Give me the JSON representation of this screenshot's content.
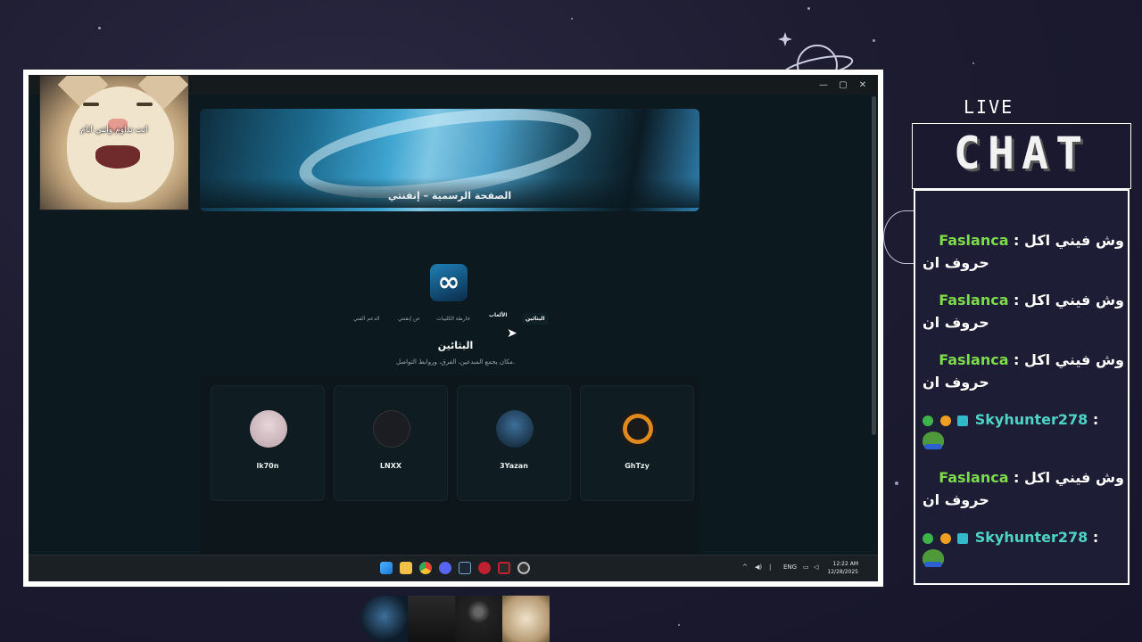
{
  "window": {
    "title": "",
    "controls": [
      "—",
      "▢",
      "✕"
    ]
  },
  "banner": {
    "caption": "الصفحة الرسمية – إنفنتي",
    "logo_text": "انفنتي"
  },
  "site": {
    "logo_glyph": "∞"
  },
  "nav": [
    {
      "label": "البثائين",
      "state": "active"
    },
    {
      "label": "الألعاب",
      "state": "hover"
    },
    {
      "label": "خارطة الكليبات",
      "state": "normal"
    },
    {
      "label": "عن إنفنتي",
      "state": "normal"
    },
    {
      "label": "الدعم الفني",
      "state": "normal"
    }
  ],
  "section": {
    "title": "البثائين",
    "subtitle": "مكان يجمع المبدعين، الفرق، وروابط التواصل."
  },
  "cards": [
    {
      "name": "lk70n",
      "avatar_color": "#cfc0c6"
    },
    {
      "name": "LNXX",
      "avatar_color": "#1b1d22"
    },
    {
      "name": "3Yazan",
      "avatar_color": "#1e3f5a"
    },
    {
      "name": "GhTzy",
      "avatar_color": "#1a1a1a"
    }
  ],
  "taskbar": {
    "icons": [
      "windows-icon",
      "file-explorer-icon",
      "chrome-icon",
      "discord-icon",
      "steam-icon",
      "app-red-icon",
      "app-redsq-icon",
      "obs-icon"
    ],
    "tray": {
      "language": "ENG",
      "time": "12:22 AM",
      "date": "12/28/2025"
    }
  },
  "webcam": {
    "caption": "انت تداوم وانتي انام"
  },
  "chat": {
    "live_label": "LIVE",
    "title": "CHAT",
    "messages": [
      {
        "user": "Faslanca",
        "text": "وش فيني اكل",
        "line2": "حروف ان",
        "type": "text"
      },
      {
        "user": "Faslanca",
        "text": "وش فيني اكل",
        "line2": "حروف ان",
        "type": "text"
      },
      {
        "user": "Faslanca",
        "text": "وش فيني اكل",
        "line2": "حروف ان",
        "type": "text"
      },
      {
        "user": "Skyhunter278",
        "text": ":",
        "line2": "",
        "type": "emote"
      },
      {
        "user": "Faslanca",
        "text": "وش فيني اكل",
        "line2": "حروف ان",
        "type": "text"
      },
      {
        "user": "Skyhunter278",
        "text": ":",
        "line2": "",
        "type": "emote"
      }
    ]
  },
  "colors": {
    "accent_green": "#7ddc4a",
    "accent_teal": "#4fd4c4",
    "bg": "#1d1c30"
  }
}
